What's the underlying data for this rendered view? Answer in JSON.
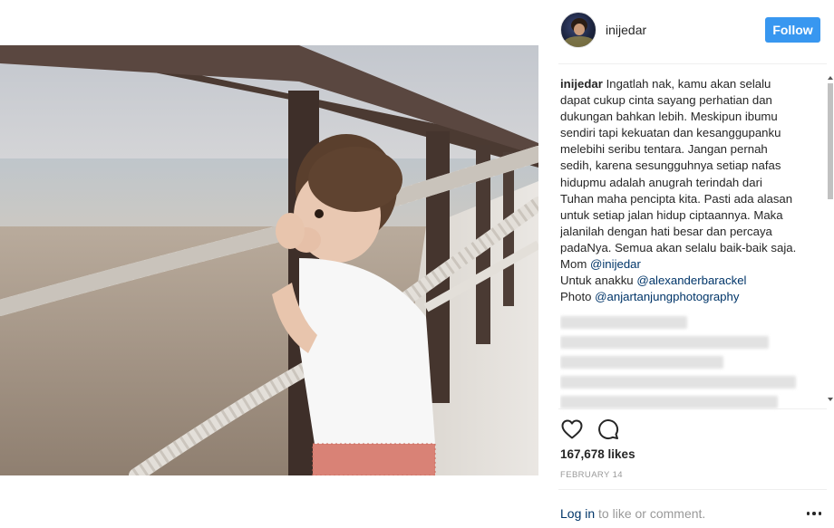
{
  "post": {
    "photo_alt": "",
    "username": "inijedar",
    "follow_label": "Follow",
    "caption": {
      "user": "inijedar",
      "lines": [
        "Ingatlah nak, kamu akan selalu",
        "dapat cukup cinta sayang perhatian dan",
        "dukungan bahkan lebih. Meskipun ibumu",
        "sendiri tapi kekuatan dan kesanggupanku",
        "melebihi seribu tentara. Jangan pernah",
        "sedih, karena sesungguhnya setiap nafas",
        "hidupmu adalah anugrah terindah dari",
        "Tuhan maha pencipta kita. Pasti ada alasan",
        "untuk setiap jalan hidup ciptaannya. Maka",
        "jalanilah dengan hati besar dan percaya",
        "padaNya. Semua akan selalu baik-baik saja."
      ],
      "mom_prefix": "Mom",
      "mom_mention": "@inijedar",
      "child_prefix": "Untuk anakku",
      "child_mention": "@alexanderbarackel",
      "photo_prefix": "Photo",
      "photo_mention": "@anjartanjungphotography"
    },
    "likes": "167,678 likes",
    "date": "FEBRUARY 14",
    "login_link": "Log in",
    "login_rest": " to like or comment.",
    "icons": {
      "heart": "heart-icon",
      "comment": "comment-icon",
      "more": "more-options-icon"
    },
    "colors": {
      "follow_button": "#3897f0",
      "mention": "#003569",
      "muted": "#999999"
    }
  }
}
